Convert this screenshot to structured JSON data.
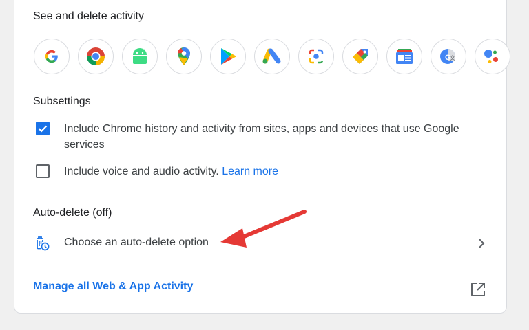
{
  "sections": {
    "activity_title": "See and delete activity",
    "subsettings_title": "Subsettings",
    "autodelete_title": "Auto-delete (off)"
  },
  "apps": [
    {
      "name": "Google Search",
      "icon": "google-g-icon"
    },
    {
      "name": "Chrome",
      "icon": "chrome-icon"
    },
    {
      "name": "Android",
      "icon": "android-icon"
    },
    {
      "name": "Maps",
      "icon": "maps-pin-icon"
    },
    {
      "name": "Play",
      "icon": "play-store-icon"
    },
    {
      "name": "Ads",
      "icon": "google-ads-icon"
    },
    {
      "name": "Lens",
      "icon": "lens-icon"
    },
    {
      "name": "Shopping",
      "icon": "shopping-tag-icon"
    },
    {
      "name": "News",
      "icon": "news-icon"
    },
    {
      "name": "Translate",
      "icon": "translate-icon"
    },
    {
      "name": "Assistant",
      "icon": "assistant-icon"
    }
  ],
  "subsettings": {
    "chrome_history": {
      "line1": "Include Chrome history and activity from sites, apps and devices that use Google",
      "line2": "services",
      "checked": true
    },
    "voice_audio": {
      "label": "Include voice and audio activity.",
      "link": "Learn more",
      "checked": false
    }
  },
  "autodelete": {
    "option_label": "Choose an auto-delete option",
    "icon": "trash-clock-icon",
    "chevron_icon": "chevron-right-icon"
  },
  "manage": {
    "label": "Manage all Web & App Activity",
    "icon": "open-in-new-icon"
  },
  "annotation": {
    "icon": "red-arrow-annotation",
    "color": "#e53935"
  },
  "colors": {
    "accent": "#1a73e8",
    "text": "#3c4043",
    "divider": "#dadce0"
  }
}
